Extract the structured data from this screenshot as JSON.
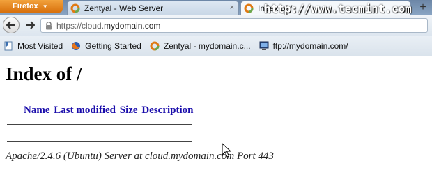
{
  "browser": {
    "menu_label": "Firefox",
    "tabs": [
      {
        "title": "Zentyal - Web Server",
        "close": "×"
      },
      {
        "title": "Index of /",
        "close": "×"
      }
    ],
    "new_tab": "+",
    "watermark": "http://www.tecmint.com",
    "url_prefix": "https://cloud.",
    "url_domain": "mydomain.com"
  },
  "bookmarks": [
    {
      "label": "Most Visited",
      "icon": "bookmark-icon"
    },
    {
      "label": "Getting Started",
      "icon": "firefox-icon"
    },
    {
      "label": "Zentyal - mydomain.c...",
      "icon": "zentyal-icon"
    },
    {
      "label": "ftp://mydomain.com/",
      "icon": "computer-icon"
    }
  ],
  "page": {
    "heading": "Index of /",
    "columns": [
      "Name",
      "Last modified",
      "Size",
      "Description"
    ],
    "server_signature": "Apache/2.4.6 (Ubuntu) Server at cloud.mydomain.com Port 443"
  },
  "colors": {
    "link": "#1a0dab",
    "firefox_button": "#e07a14",
    "tab_strip": "#7a94b4"
  }
}
